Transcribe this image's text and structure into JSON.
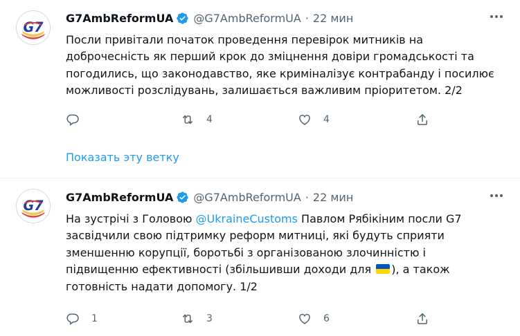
{
  "tweets": [
    {
      "name": "G7AmbReformUA",
      "handle": "@G7AmbReformUA",
      "separator": "·",
      "time": "22 мин",
      "text": "Посли привітали початок проведення перевірок митників на доброчесність як перший крок до зміцнення довіри громадськості та погодились, що законодавство, яке криміналізує контрабанду і посилює можливості розслідувань, залишається важливим пріоритетом. 2/2",
      "replies": "",
      "retweets": "4",
      "likes": "4"
    },
    {
      "name": "G7AmbReformUA",
      "handle": "@G7AmbReformUA",
      "separator": "·",
      "time": "22 мин",
      "text_before_mention": "На зустрічі з Головою ",
      "mention": "@UkraineCustoms",
      "text_after_mention": " Павлом Рябікіним посли G7 засвідчили свою підтримку реформ митниці, які будуть сприяти зменшенню корупції, боротьбі з організованою злочинністю і підвищенню ефективності (збільшивши доходи для ",
      "text_after_flag": "), а також готовність надати допомогу. 1/2",
      "replies": "1",
      "retweets": "3",
      "likes": "6"
    }
  ],
  "thread_link": "Показать эту ветку",
  "icons": {
    "avatar": "g7-logo",
    "verified": "verified-badge-icon",
    "more": "more-options-icon",
    "reply": "reply-icon",
    "retweet": "retweet-icon",
    "like": "heart-icon",
    "share": "share-icon",
    "flag": "ukraine-flag-emoji"
  },
  "colors": {
    "accent": "#1d9bf0",
    "text": "#0f1419",
    "secondary": "#536471",
    "divider": "#eff3f4",
    "flag_blue": "#0057b7",
    "flag_yellow": "#ffd700"
  }
}
